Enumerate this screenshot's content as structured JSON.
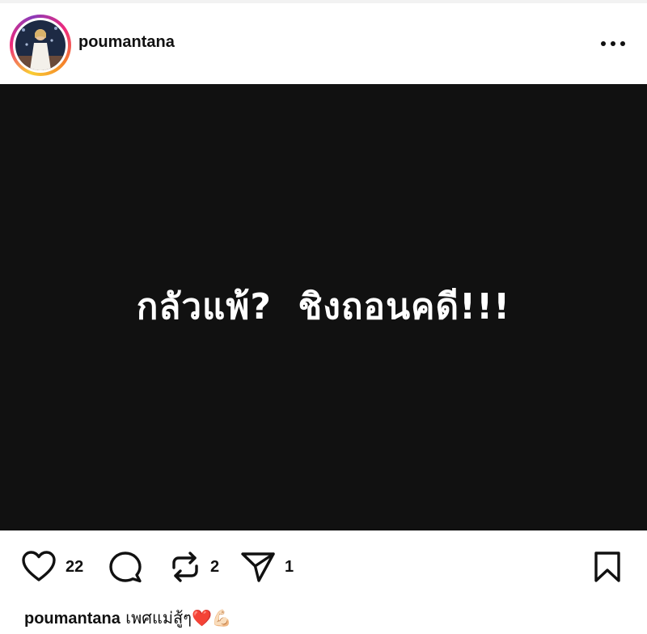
{
  "header": {
    "username": "poumantana"
  },
  "post": {
    "image_text": "กลัวแพ้?  ชิงถอนคดี!!!",
    "image_background": "#111111",
    "image_text_color": "#ffffff"
  },
  "actions": {
    "like_count": "22",
    "repost_count": "2",
    "share_count": "1"
  },
  "caption": {
    "username": "poumantana",
    "text": "เพศแม่สู้ๆ",
    "emoji_heart": "❤️",
    "emoji_muscle": "💪🏻"
  },
  "icons": [
    "heart-icon",
    "comment-icon",
    "repost-icon",
    "send-icon",
    "bookmark-icon",
    "more-options-icon"
  ]
}
